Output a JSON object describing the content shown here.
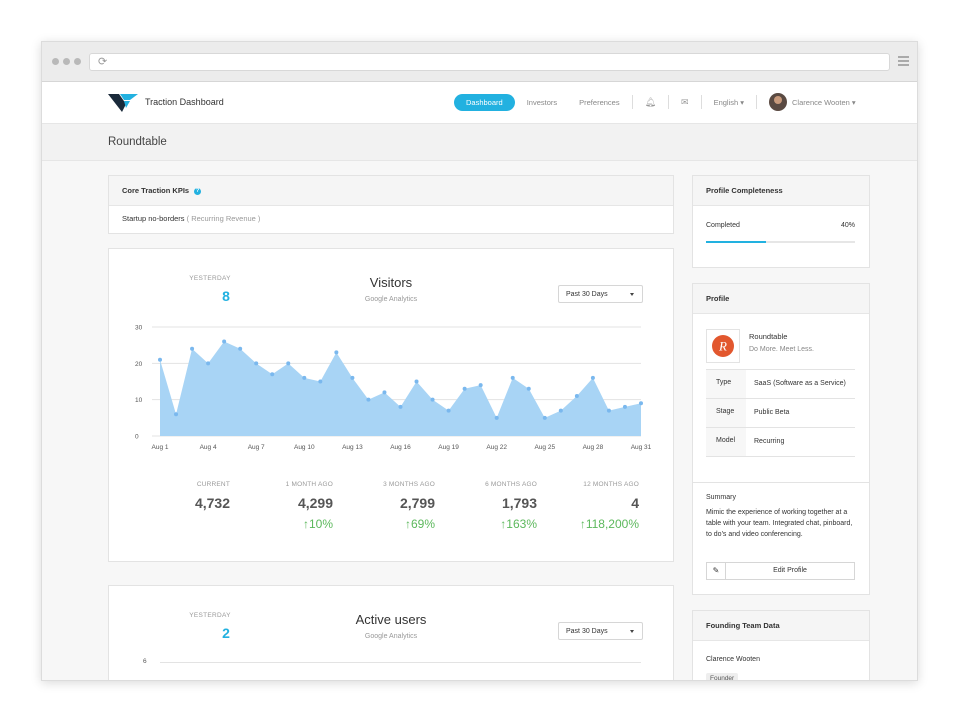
{
  "app": {
    "title": "Traction Dashboard"
  },
  "nav": {
    "items": [
      "Dashboard",
      "Investors",
      "Preferences"
    ],
    "language": "English ▾",
    "user": "Clarence Wooten ▾"
  },
  "page": {
    "title": "Roundtable"
  },
  "kpi": {
    "header": "Core Traction KPIs",
    "company": "Startup no-borders",
    "metric": "( Recurring Revenue )"
  },
  "visitors": {
    "yesterday_label": "YESTERDAY",
    "yesterday_value": "8",
    "title": "Visitors",
    "source": "Google Analytics",
    "range": "Past 30 Days",
    "stats": [
      {
        "label": "CURRENT",
        "value": "4,732",
        "change": ""
      },
      {
        "label": "1 MONTH AGO",
        "value": "4,299",
        "change": "↑10%"
      },
      {
        "label": "3 MONTHS AGO",
        "value": "2,799",
        "change": "↑69%"
      },
      {
        "label": "6 MONTHS AGO",
        "value": "1,793",
        "change": "↑163%"
      },
      {
        "label": "12 MONTHS AGO",
        "value": "4",
        "change": "↑118,200%"
      }
    ]
  },
  "active_users": {
    "yesterday_label": "YESTERDAY",
    "yesterday_value": "2",
    "title": "Active users",
    "source": "Google Analytics",
    "range": "Past 30 Days",
    "y_tick_top": "6"
  },
  "chart_data": {
    "type": "area",
    "title": "Visitors",
    "x": [
      "Aug 1",
      "Aug 2",
      "Aug 3",
      "Aug 4",
      "Aug 5",
      "Aug 6",
      "Aug 7",
      "Aug 8",
      "Aug 9",
      "Aug 10",
      "Aug 11",
      "Aug 12",
      "Aug 13",
      "Aug 14",
      "Aug 15",
      "Aug 16",
      "Aug 17",
      "Aug 18",
      "Aug 19",
      "Aug 20",
      "Aug 21",
      "Aug 22",
      "Aug 23",
      "Aug 24",
      "Aug 25",
      "Aug 26",
      "Aug 27",
      "Aug 28",
      "Aug 29",
      "Aug 30",
      "Aug 31"
    ],
    "x_ticks": [
      "Aug 1",
      "Aug 4",
      "Aug 7",
      "Aug 10",
      "Aug 13",
      "Aug 16",
      "Aug 19",
      "Aug 22",
      "Aug 25",
      "Aug 28",
      "Aug 31"
    ],
    "series": [
      {
        "values": [
          21,
          6,
          24,
          20,
          26,
          24,
          20,
          17,
          20,
          16,
          15,
          23,
          16,
          10,
          12,
          8,
          15,
          10,
          7,
          13,
          14,
          5,
          16,
          13,
          5,
          7,
          11,
          16,
          7,
          8,
          9
        ]
      }
    ],
    "ylim": [
      0,
      30
    ],
    "y_ticks": [
      0,
      10,
      20,
      30
    ],
    "grid": true,
    "color": "#a8d4f5",
    "point_color": "#7ab8ee"
  },
  "profile_completeness": {
    "header": "Profile Completeness",
    "label": "Completed",
    "percent_text": "40%",
    "fraction": 0.4
  },
  "profile": {
    "header": "Profile",
    "name": "Roundtable",
    "tagline": "Do More. Meet Less.",
    "rows": [
      {
        "key": "Type",
        "value": "SaaS (Software as a Service)"
      },
      {
        "key": "Stage",
        "value": "Public Beta"
      },
      {
        "key": "Model",
        "value": "Recurring"
      }
    ],
    "summary_label": "Summary",
    "summary": "Mimic the experience of working together at a table with your team. Integrated chat, pinboard, to do's and video conferencing.",
    "edit_label": "Edit Profile"
  },
  "founding": {
    "header": "Founding Team Data",
    "member": "Clarence Wooten",
    "role": "Founder"
  },
  "colors": {
    "accent": "#22b1e0",
    "positive": "#5cb85c"
  }
}
